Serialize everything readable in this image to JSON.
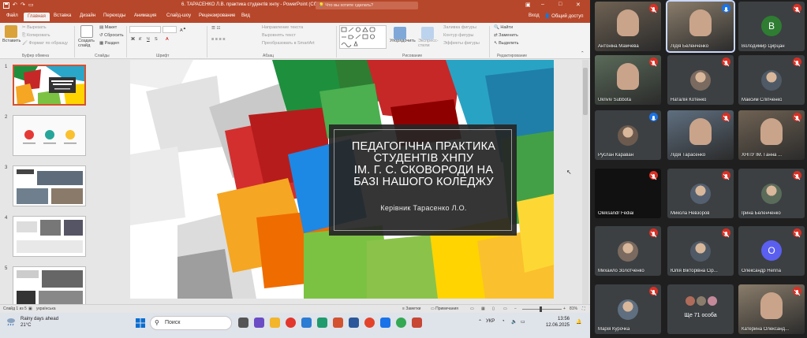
{
  "window": {
    "title": "6. ТАРАСЕНКО Л.В. практика студентів хнпу  -  PowerPoint (Сбой активации продукта)",
    "search_placeholder": "Что вы хотите сделать?",
    "controls": [
      "–",
      "□",
      "✕"
    ]
  },
  "tabs": [
    "Файл",
    "Главная",
    "Вставка",
    "Дизайн",
    "Переходы",
    "Анимация",
    "Слайд-шоу",
    "Рецензирование",
    "Вид"
  ],
  "active_tab": "Главная",
  "account": {
    "signin": "Вход",
    "share": "Общий доступ"
  },
  "ribbon": {
    "paste": "Вставить",
    "cut": "Вырезать",
    "copy": "Копировать",
    "format_painter": "Формат по образцу",
    "clipboard_group": "Буфер обмена",
    "new_slide": "Создать слайд",
    "layout": "Макет",
    "reset": "Сбросить",
    "section": "Раздел",
    "slides_group": "Слайды",
    "font_group": "Шрифт",
    "text_direction": "Направление текста",
    "align_text": "Выровнять текст",
    "smartart": "Преобразовать в SmartArt",
    "paragraph_group": "Абзац",
    "arrange": "Упорядочить",
    "quick_styles": "Экспресс-стили",
    "shape_fill": "Заливка фигуры",
    "shape_outline": "Контур фигуры",
    "shape_effects": "Эффекты фигуры",
    "drawing_group": "Рисование",
    "find": "Найти",
    "replace": "Заменить",
    "select": "Выделить",
    "editing_group": "Редактирование"
  },
  "thumbnails": [
    {
      "num": "1"
    },
    {
      "num": "2"
    },
    {
      "num": "3"
    },
    {
      "num": "4"
    },
    {
      "num": "5"
    }
  ],
  "slide": {
    "title_lines": [
      "ПЕДАГОГІЧНА ПРАКТИКА",
      "СТУДЕНТІВ ХНПУ",
      "ІМ. Г. С. СКОВОРОДИ НА",
      "БАЗІ НАШОГО КОЛЕДЖУ"
    ],
    "subtitle": "Керівник Тарасенко Л.О."
  },
  "status": {
    "slide_of": "Слайд 1 из 5",
    "language": "українська",
    "notes": "Заметки",
    "comments": "Примечания",
    "zoom": "81%"
  },
  "taskbar": {
    "weather": "Rainy days ahead",
    "temperature": "21°C",
    "search": "Поиск",
    "lang": "УКР",
    "time": "13:56",
    "date": "12.06.2025"
  },
  "participants": [
    {
      "name": "Антоніна Мамчева",
      "type": "video",
      "mic": "muted"
    },
    {
      "name": "Лідія Беленченко",
      "type": "video",
      "mic": "blue",
      "active": true
    },
    {
      "name": "Володимир Цирцан",
      "type": "letter",
      "letter": "В",
      "color": "#2e7d32",
      "mic": "muted"
    },
    {
      "name": "Ukriviv Subbota",
      "type": "video",
      "mic": "muted"
    },
    {
      "name": "Наталія Котенко",
      "type": "avatar",
      "mic": "muted"
    },
    {
      "name": "Максим Сліпченко",
      "type": "avatar",
      "mic": "muted"
    },
    {
      "name": "Руслан Караван",
      "type": "avatar",
      "mic": "blue"
    },
    {
      "name": "Лідія Тарасенко",
      "type": "video",
      "mic": "muted"
    },
    {
      "name": "ХНПУ ІМ. Ганна ...",
      "type": "video",
      "mic": "muted"
    },
    {
      "name": "Oleksandr Fediai",
      "type": "dark",
      "mic": "muted"
    },
    {
      "name": "Микола Невзоров",
      "type": "avatar",
      "mic": "muted"
    },
    {
      "name": "Ірина Беленченко",
      "type": "avatar",
      "mic": "muted"
    },
    {
      "name": "Михайло Золотченко",
      "type": "avatar",
      "mic": "muted"
    },
    {
      "name": "Юлія Вікторівна Сір...",
      "type": "avatar",
      "mic": "muted"
    },
    {
      "name": "Олександр Herina",
      "type": "letter",
      "letter": "O",
      "color": "#5b5ff0",
      "mic": "muted"
    },
    {
      "name": "Марія Курочка",
      "type": "avatar",
      "mic": "muted"
    },
    {
      "name": "Ще 71 особа",
      "type": "more",
      "mic": "none"
    },
    {
      "name": "Катерина Олександ...",
      "type": "video",
      "mic": "muted"
    }
  ]
}
